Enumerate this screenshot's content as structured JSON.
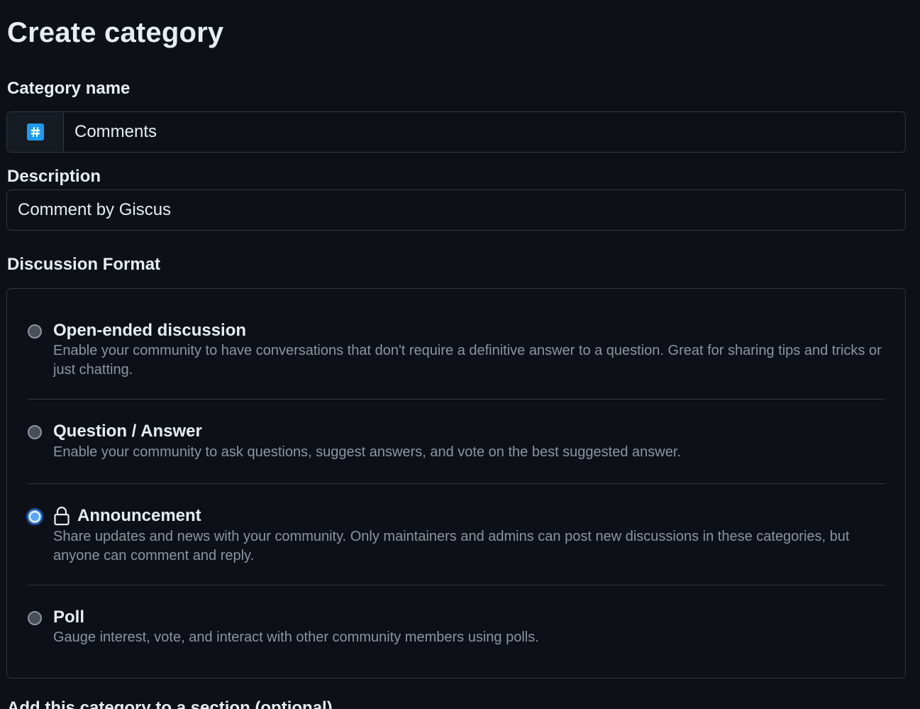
{
  "page": {
    "title": "Create category"
  },
  "category_name": {
    "label": "Category name",
    "emoji_icon": "hash-icon",
    "value": "Comments"
  },
  "description": {
    "label": "Description",
    "value": "Comment by Giscus"
  },
  "discussion_format": {
    "label": "Discussion Format",
    "selected": "Announcement",
    "options": [
      {
        "title": "Open-ended discussion",
        "description": "Enable your community to have conversations that don't require a definitive answer to a question. Great for sharing tips and tricks or just chatting.",
        "checked": false
      },
      {
        "title": "Question / Answer",
        "description": "Enable your community to ask questions, suggest answers, and vote on the best suggested answer.",
        "checked": false
      },
      {
        "title": "Announcement",
        "icon": "lock-icon",
        "description": "Share updates and news with your community. Only maintainers and admins can post new discussions in these categories, but anyone can comment and reply.",
        "checked": true
      },
      {
        "title": "Poll",
        "description": "Gauge interest, vote, and interact with other community members using polls.",
        "checked": false
      }
    ]
  },
  "section_group": {
    "label": "Add this category to a section (optional)"
  },
  "colors": {
    "background": "#0d1117",
    "border": "#30363d",
    "text": "#e6edf3",
    "muted_text": "#8b949e",
    "accent": "#58a6ff",
    "emoji_bg": "#1d9bf0"
  }
}
